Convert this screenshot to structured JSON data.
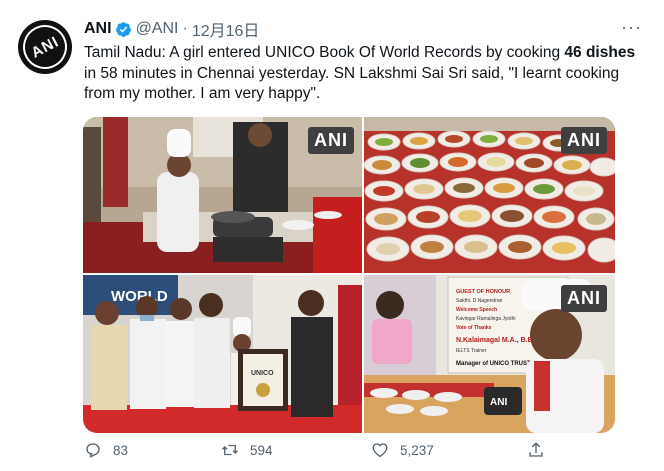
{
  "tweet": {
    "author_name": "ANI",
    "handle": "@ANI",
    "separator": "·",
    "date": "12月16日",
    "avatar_text": "ANI",
    "text_part1": "Tamil Nadu: A girl entered UNICO Book Of World Records by cooking ",
    "text_bold": "46 dishes",
    "text_part2": " in 58 minutes in Chennai yesterday. SN Lakshmi Sai Sri said, \"I learnt cooking from my mother. I am very happy\".",
    "replies": "83",
    "retweets": "594",
    "likes": "5,237"
  },
  "media": {
    "watermark": "ANI",
    "photo3": {
      "banner": "WORLD",
      "certificate": "UNICO"
    },
    "photo4": {
      "banner_lines": [
        "GUEST OF HONOUR",
        "Sakthi. D.Nagendran",
        "Welcome Speech",
        "Kavingar Ramalinga Jyothi",
        "Vote of Thanks"
      ],
      "banner_name": "N.Kalaimagal M.A., B.Ed.,",
      "banner_role": "IELTS Trainer",
      "banner_footer": "Manager of UNICO TRUST",
      "mic_label": "ANI"
    }
  },
  "icons": {
    "verified": "verified-badge-icon",
    "more": "more-options-icon",
    "reply": "reply-icon",
    "retweet": "retweet-icon",
    "like": "heart-icon",
    "share": "share-icon"
  },
  "colors": {
    "verified": "#1d9bf0",
    "secondary_text": "#536471",
    "primary_text": "#0f1419"
  }
}
